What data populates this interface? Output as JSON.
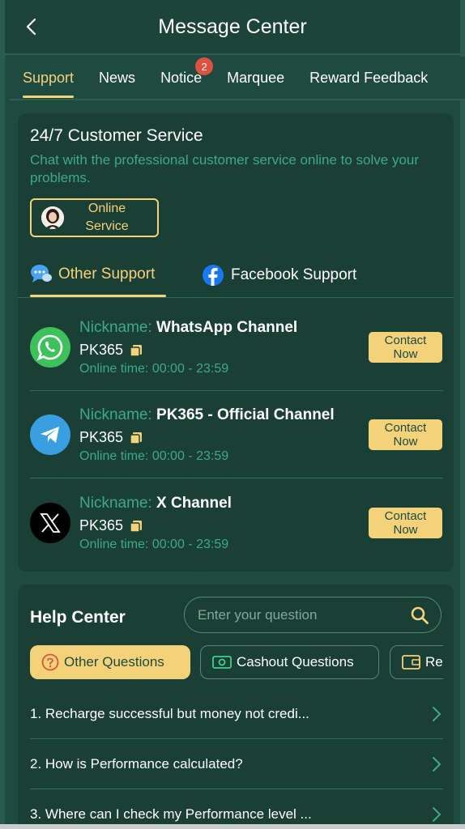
{
  "header": {
    "title": "Message Center"
  },
  "tabs": [
    {
      "label": "Support",
      "active": true
    },
    {
      "label": "News"
    },
    {
      "label": "Notice",
      "badge": "2"
    },
    {
      "label": "Marquee"
    },
    {
      "label": "Reward Feedback"
    }
  ],
  "customer_service": {
    "title": "24/7 Customer Service",
    "description": "Chat with the professional customer service online to solve your problems.",
    "online_button_line1": "Online",
    "online_button_line2": "Service"
  },
  "support_tabs": [
    {
      "label": "Other Support",
      "active": true,
      "icon": "chat-bubbles-icon"
    },
    {
      "label": "Facebook Support",
      "icon": "facebook-icon"
    }
  ],
  "channels": [
    {
      "nick_label": "Nickname: ",
      "name": "WhatsApp Channel",
      "id": "PK365",
      "time": "Online time: 00:00 - 23:59",
      "icon": "whatsapp-icon",
      "button_line1": "Contact",
      "button_line2": "Now"
    },
    {
      "nick_label": "Nickname: ",
      "name": "PK365 - Official Channel",
      "id": "PK365",
      "time": "Online time: 00:00 - 23:59",
      "icon": "telegram-icon",
      "button_line1": "Contact",
      "button_line2": "Now"
    },
    {
      "nick_label": "Nickname: ",
      "name": "X Channel",
      "id": "PK365",
      "time": "Online time: 00:00 - 23:59",
      "icon": "x-icon",
      "button_line1": "Contact",
      "button_line2": "Now"
    }
  ],
  "help_center": {
    "title": "Help Center",
    "search_placeholder": "Enter your question",
    "question_tabs": [
      {
        "label": "Other Questions",
        "active": true,
        "icon": "question-circle-icon"
      },
      {
        "label": "Cashout Questions",
        "icon": "cash-icon"
      },
      {
        "label": "Re",
        "icon": "wallet-icon"
      }
    ],
    "faqs": [
      "1. Recharge successful but money not credi...",
      "2. How is Performance calculated?",
      "3. Where can I check my Performance level ..."
    ]
  },
  "colors": {
    "background": "#1e4a3f",
    "card": "#1a3f35",
    "accent": "#f3d27a",
    "muted_text": "#3fa887",
    "badge": "#e0523f"
  }
}
